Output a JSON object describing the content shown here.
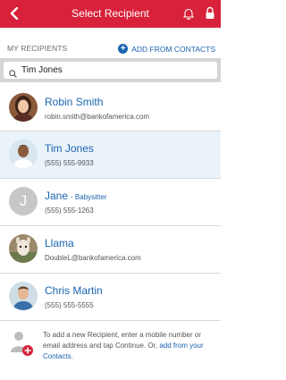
{
  "header": {
    "title": "Select Recipient"
  },
  "section": {
    "label": "MY RECIPIENTS",
    "add_label": "ADD FROM CONTACTS"
  },
  "search": {
    "value": "Tim Jones"
  },
  "recipients": [
    {
      "name": "Robin Smith",
      "nickname": "",
      "detail": "robin.smith@bankofamerica.com"
    },
    {
      "name": "Tim Jones",
      "nickname": "",
      "detail": "(555) 555-9933"
    },
    {
      "name": "Jane",
      "nickname": "- Babysitter",
      "detail": "(555) 555-1263",
      "initial": "J"
    },
    {
      "name": "Llama",
      "nickname": "",
      "detail": "DoubleL@bankofamerica.com"
    },
    {
      "name": "Chris Martin",
      "nickname": "",
      "detail": "(555) 555-5555"
    }
  ],
  "footer": {
    "text": "To add a new Recipient, enter a mobile number or email address and tap Continue. Or,",
    "link": "add from your Contacts",
    "end": "."
  },
  "colors": {
    "header": "#d8213a",
    "link": "#1a64b0",
    "selected_row": "#eaf2fa"
  }
}
